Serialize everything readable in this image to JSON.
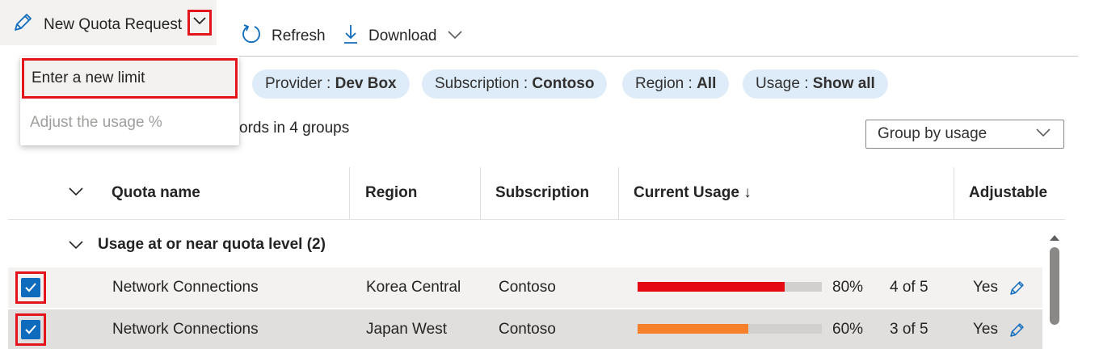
{
  "toolbar": {
    "new_quota_label": "New Quota Request",
    "refresh_label": "Refresh",
    "download_label": "Download"
  },
  "menu": {
    "items": [
      {
        "label": "Enter a new limit",
        "enabled": true
      },
      {
        "label": "Adjust the usage %",
        "enabled": false
      }
    ]
  },
  "filters": [
    {
      "key": "Provider : ",
      "value": "Dev Box"
    },
    {
      "key": "Subscription : ",
      "value": "Contoso"
    },
    {
      "key": "Region : ",
      "value": "All"
    },
    {
      "key": "Usage : ",
      "value": "Show all"
    }
  ],
  "records_text_prefix": "ords in ",
  "records_text_groups": "4 groups",
  "group_by": {
    "selected": "Group by usage"
  },
  "table": {
    "columns": [
      "Quota name",
      "Region",
      "Subscription",
      "Current Usage ↓",
      "Adjustable"
    ],
    "group": {
      "label": "Usage at or near quota level (2)"
    },
    "rows": [
      {
        "name": "Network Connections",
        "region": "Korea Central",
        "subscription": "Contoso",
        "usage_fraction": 0.8,
        "usage_pct": "80%",
        "usage_count": "4 of 5",
        "adjustable": "Yes",
        "bar_color": "#e50914"
      },
      {
        "name": "Network Connections",
        "region": "Japan West",
        "subscription": "Contoso",
        "usage_fraction": 0.6,
        "usage_pct": "60%",
        "usage_count": "3 of 5",
        "adjustable": "Yes",
        "bar_color": "#f7812b"
      }
    ]
  },
  "colors": {
    "accent": "#0f6cbd",
    "highlight": "#e3141b",
    "pill_bg": "#deecf9"
  }
}
